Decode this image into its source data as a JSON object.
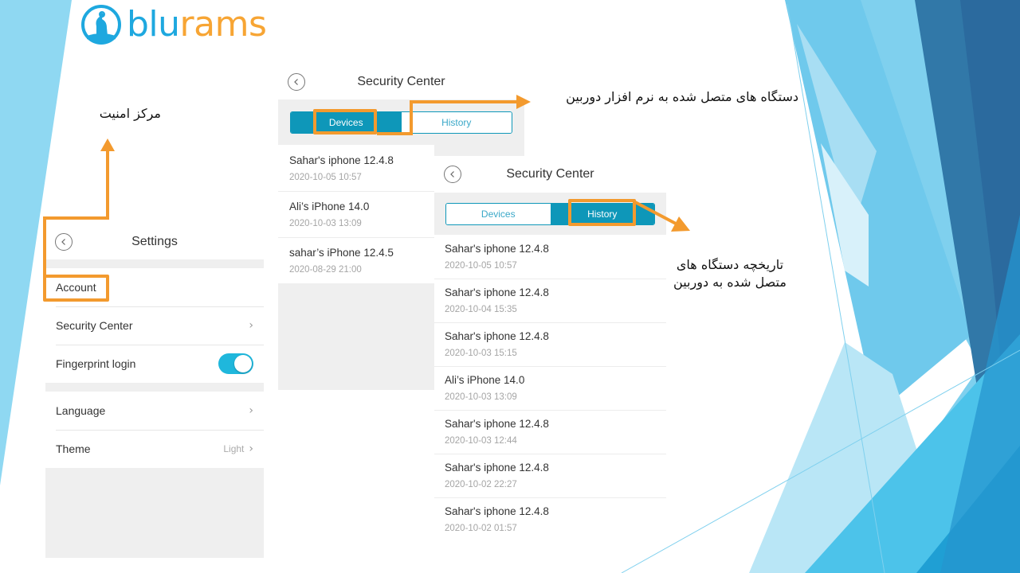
{
  "brand": {
    "logo_icon": "ram-icon",
    "name_part1": "blu",
    "name_part2": "rams",
    "color_primary": "#1ea8df",
    "color_secondary": "#f7a534"
  },
  "annotations": {
    "accent_color": "#f39a2e",
    "security_center_label": "مرکز امنیت",
    "connected_devices_label": "دستگاه های متصل شده به نرم افزار دوربین",
    "history_label_line1": "تاریخچه دستگاه های",
    "history_label_line2": "متصل شده به دوربین"
  },
  "settings": {
    "title": "Settings",
    "back_icon": "chevron-left-circle-icon",
    "items": [
      {
        "label": "Account"
      },
      {
        "label": "Security Center",
        "icon": "chevron-right-icon",
        "chevron": "›"
      },
      {
        "label": "Fingerprint login",
        "toggle": true
      }
    ],
    "items2": [
      {
        "label": "Language",
        "icon": "chevron-right-icon",
        "chevron": "›"
      },
      {
        "label": "Theme",
        "value": "Light",
        "icon": "chevron-right-icon",
        "chevron": "›"
      }
    ],
    "toggle_color": "#1fb7dc"
  },
  "devices_screen": {
    "title": "Security Center",
    "tabs": [
      {
        "label": "Devices",
        "active": true
      },
      {
        "label": "History",
        "active": false
      }
    ],
    "tab_color": "#0e97b9",
    "devices": [
      {
        "name": "Sahar's iphone 12.4.8",
        "date": "2020-10-05 10:57"
      },
      {
        "name": "Ali’s iPhone 14.0",
        "date": "2020-10-03 13:09"
      },
      {
        "name": "sahar’s iPhone 12.4.5",
        "date": "2020-08-29 21:00"
      }
    ]
  },
  "history_screen": {
    "title": "Security Center",
    "tabs": [
      {
        "label": "Devices",
        "active": false
      },
      {
        "label": "History",
        "active": true
      }
    ],
    "history": [
      {
        "name": "Sahar's iphone 12.4.8",
        "date": "2020-10-05 10:57"
      },
      {
        "name": "Sahar's iphone 12.4.8",
        "date": "2020-10-04 15:35"
      },
      {
        "name": "Sahar's iphone 12.4.8",
        "date": "2020-10-03 15:15"
      },
      {
        "name": "Ali’s iPhone 14.0",
        "date": "2020-10-03 13:09"
      },
      {
        "name": "Sahar's iphone 12.4.8",
        "date": "2020-10-03 12:44"
      },
      {
        "name": "Sahar's iphone 12.4.8",
        "date": "2020-10-02 22:27"
      },
      {
        "name": "Sahar's iphone 12.4.8",
        "date": "2020-10-02 01:57"
      }
    ]
  }
}
